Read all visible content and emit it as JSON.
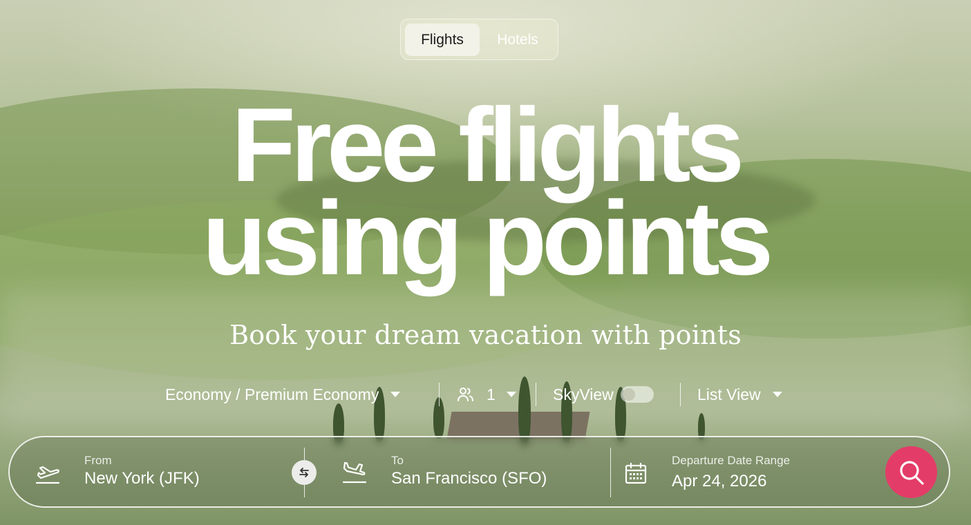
{
  "tabs": [
    {
      "label": "Flights",
      "active": true
    },
    {
      "label": "Hotels",
      "active": false
    }
  ],
  "hero": {
    "line1": "Free flights",
    "line2": "using points",
    "subtitle": "Book your dream vacation with points"
  },
  "options": {
    "cabin": "Economy / Premium Economy",
    "passengers": "1",
    "skyview_label": "SkyView",
    "skyview_enabled": false,
    "view": "List View"
  },
  "search": {
    "from_label": "From",
    "from_value": "New York (JFK)",
    "to_label": "To",
    "to_value": "San Francisco (SFO)",
    "date_label": "Departure Date Range",
    "date_value": "Apr 24, 2026"
  },
  "icons": {
    "takeoff": "plane-takeoff-icon",
    "landing": "plane-landing-icon",
    "swap": "swap-icon",
    "calendar": "calendar-icon",
    "search": "search-icon",
    "passengers": "users-icon",
    "caret": "chevron-down-icon"
  },
  "colors": {
    "accent": "#e43c68",
    "active_tab_bg": "#f3f2e8"
  }
}
